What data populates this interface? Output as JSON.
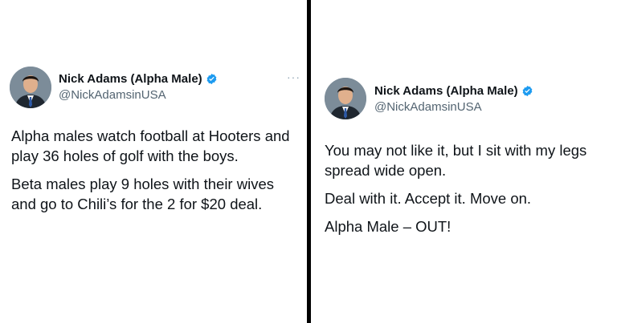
{
  "tweets": [
    {
      "author": {
        "name": "Nick Adams (Alpha Male)",
        "handle": "@NickAdamsinUSA",
        "verified": true
      },
      "more_icon": "more-horizontal-icon",
      "paragraphs": [
        "Alpha males watch football at Hooters and play 36 holes of golf with the boys.",
        "Beta males play 9 holes with their wives and go to Chili’s for the 2 for $20 deal."
      ]
    },
    {
      "author": {
        "name": "Nick Adams (Alpha Male)",
        "handle": "@NickAdamsinUSA",
        "verified": true
      },
      "paragraphs": [
        "You may not like it, but I sit with my legs spread wide open.",
        "Deal with it. Accept it. Move on.",
        "Alpha Male – OUT!"
      ]
    }
  ],
  "colors": {
    "verified_badge": "#1d9bf0",
    "handle": "#536471",
    "divider": "#000000"
  },
  "icons": {
    "verified": "verified-badge-icon"
  }
}
